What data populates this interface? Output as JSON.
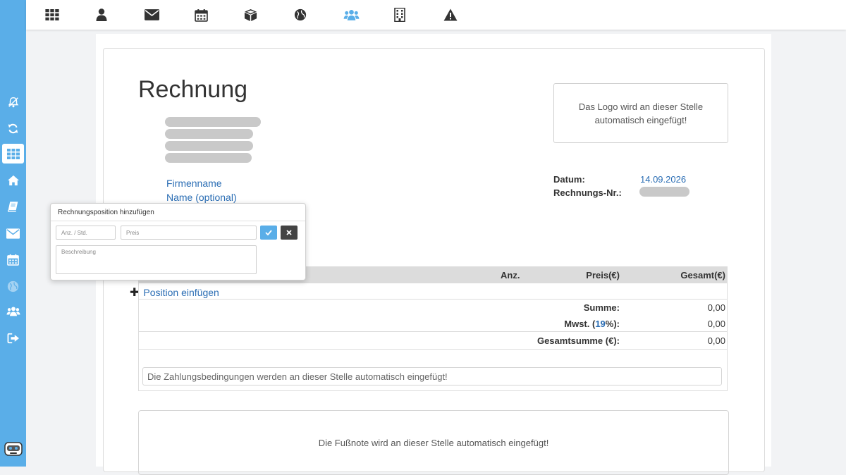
{
  "colors": {
    "sidebar": "#5aaee8",
    "link": "#2a6db4",
    "accent": "#5aaee8",
    "dark_button": "#444444"
  },
  "sidebar": {
    "items": [
      {
        "icon": "bell-slash-icon"
      },
      {
        "icon": "refresh-icon"
      },
      {
        "icon": "grid-icon",
        "active": true
      },
      {
        "icon": "home-icon"
      },
      {
        "icon": "book-icon"
      },
      {
        "icon": "envelope-icon"
      },
      {
        "icon": "calendar-icon"
      },
      {
        "icon": "globe-icon",
        "dimmed": true
      },
      {
        "icon": "users-icon"
      },
      {
        "icon": "sign-out-icon"
      }
    ],
    "bottom_icon": "robot-icon"
  },
  "topbar": {
    "items": [
      {
        "icon": "grid-icon"
      },
      {
        "icon": "user-icon"
      },
      {
        "icon": "envelope-icon"
      },
      {
        "icon": "calendar-icon"
      },
      {
        "icon": "cube-icon"
      },
      {
        "icon": "globe-icon"
      },
      {
        "icon": "users-icon",
        "active": true
      },
      {
        "icon": "building-icon"
      },
      {
        "icon": "warning-icon"
      }
    ]
  },
  "invoice": {
    "title": "Rechnung",
    "company_name": "Firmenname",
    "name_optional": "Name (optional)",
    "logo_placeholder_line1": "Das Logo wird an dieser Stelle",
    "logo_placeholder_line2": "automatisch eingefügt!",
    "date_label": "Datum:",
    "date_value": "14.09.2026",
    "invoice_no_label": "Rechnungs-Nr.:",
    "table_headers": {
      "qty": "Anz.",
      "price": "Preis(€)",
      "total": "Gesamt(€)"
    },
    "add_position": "Position einfügen",
    "sum_label": "Summe:",
    "sum_value": "0,00",
    "vat_label_prefix": "Mwst. (",
    "vat_rate": "19",
    "vat_label_suffix": "%):",
    "vat_value": "0,00",
    "grand_total_label": "Gesamtsumme (€):",
    "grand_total_value": "0,00",
    "payment_terms": "Die Zahlungsbedingungen werden an dieser Stelle automatisch eingefügt!",
    "footnote": "Die Fußnote wird an dieser Stelle automatisch eingefügt!"
  },
  "popup": {
    "title": "Rechnungsposition hinzufügen",
    "qty_placeholder": "Anz. / Std.",
    "price_placeholder": "Preis",
    "description_placeholder": "Beschreibung",
    "confirm_icon": "check-icon",
    "cancel_icon": "times-icon"
  }
}
